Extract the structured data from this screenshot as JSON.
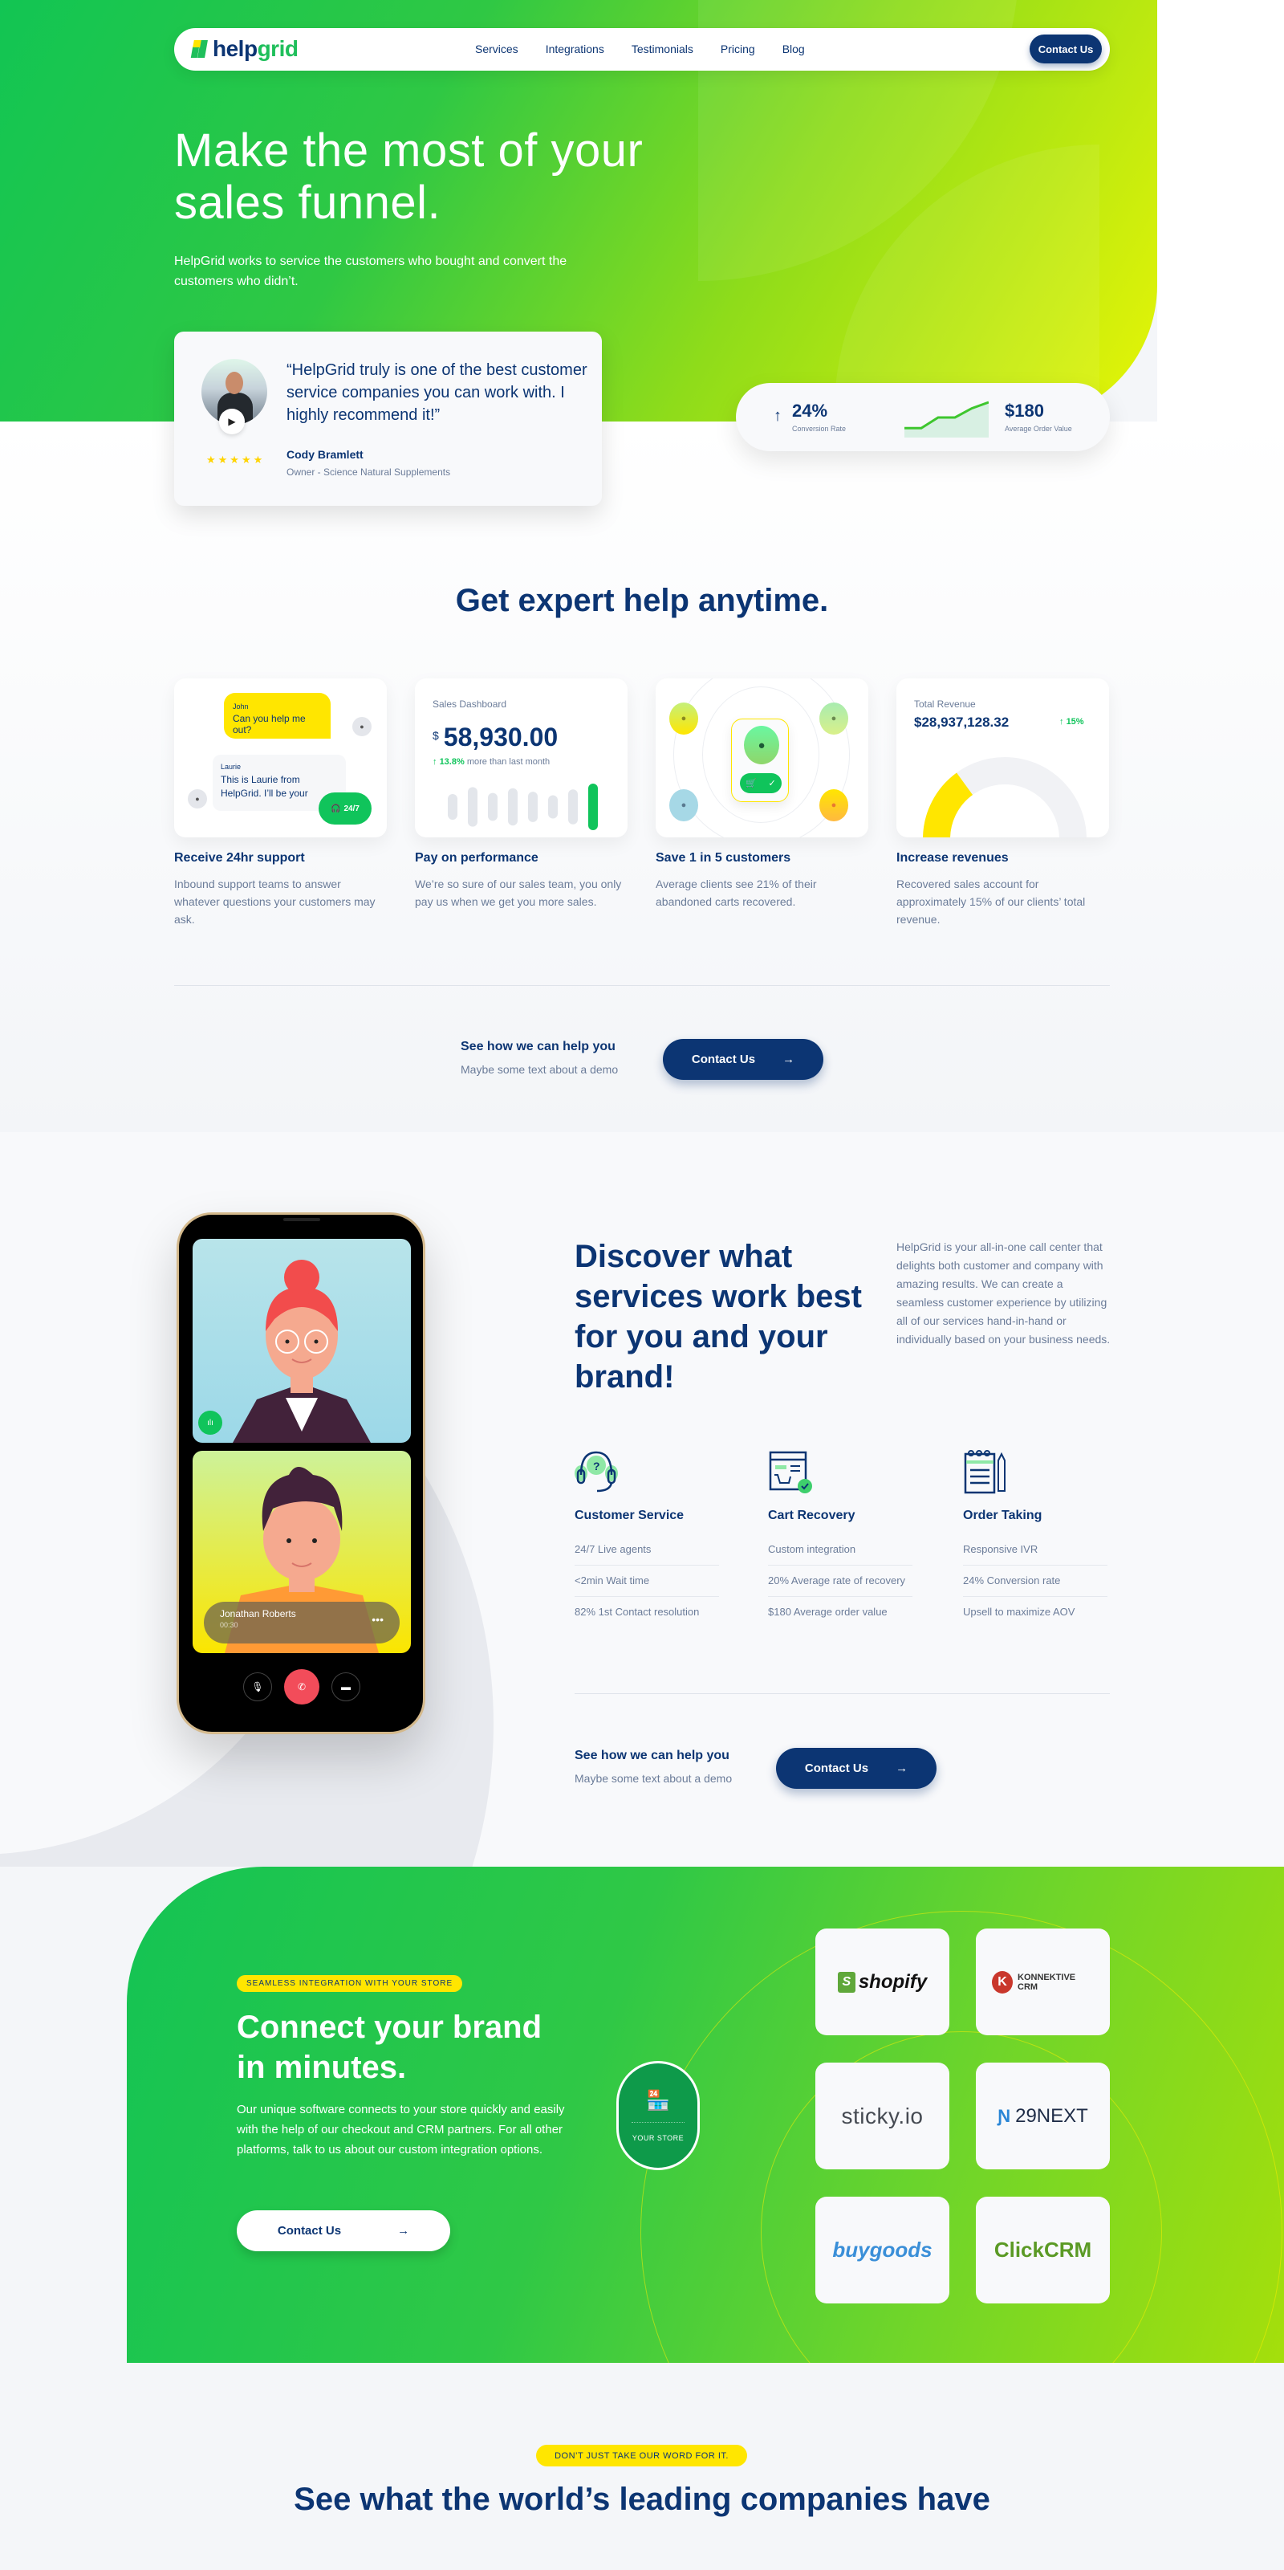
{
  "brand": {
    "name_part1": "help",
    "name_part2": "grid",
    "accent": "#1fbf5b",
    "navy": "#0c3573",
    "yellow": "#ffe600"
  },
  "nav": {
    "links": [
      "Services",
      "Integrations",
      "Testimonials",
      "Pricing",
      "Blog"
    ],
    "cta_label": "Contact Us"
  },
  "hero": {
    "title": "Make the most of your sales funnel.",
    "subtitle": "HelpGrid works to service the customers who bought and convert the customers who didn’t.",
    "testimonial": {
      "quote": "“HelpGrid truly is one of the best customer service companies you can work with. I highly recommend it!”",
      "name": "Cody Bramlett",
      "role": "Owner - Science Natural Supplements",
      "rating": 5,
      "stars": "★★★★★",
      "play_icon": "▶"
    },
    "stats": {
      "arrow": "↑",
      "conversion_value": "24%",
      "conversion_label": "Conversion Rate",
      "aov_value": "$180",
      "aov_label": "Average Order Value",
      "sparkline": [
        0.15,
        0.15,
        0.5,
        0.5,
        0.8,
        1.0
      ]
    }
  },
  "features": {
    "title": "Get expert help anytime.",
    "items": [
      {
        "title": "Receive 24hr support",
        "desc": "Inbound support teams to answer whatever questions your customers may ask.",
        "chat_user_name": "John",
        "chat_user_msg": "Can you help me out?",
        "chat_agent_name": "Laurie",
        "chat_agent_msg": "This is Laurie from HelpGrid. I’ll be your assistant today.",
        "badge": "24/7"
      },
      {
        "title": "Pay on performance",
        "desc": "We’re so sure of our sales team, you only pay us when we get you more sales.",
        "dash_label": "Sales Dashboard",
        "currency": "$",
        "amount": "58,930.00",
        "delta": "13.8%",
        "delta_text": "more than last month",
        "bars": [
          0.55,
          0.85,
          0.6,
          0.8,
          0.65,
          0.5,
          0.75,
          1.0
        ]
      },
      {
        "title": "Save 1 in 5 customers",
        "desc": "Average clients see 21% of their abandoned carts recovered."
      },
      {
        "title": "Increase revenues",
        "desc": "Recovered sales account for approximately 15% of our clients’ total revenue.",
        "rev_label": "Total Revenue",
        "rev_value": "$28,937,128.32",
        "rev_delta": "15%",
        "gauge_fraction": 0.15
      }
    ],
    "cta": {
      "title": "See how we can help you",
      "subtitle": "Maybe some text about a demo",
      "button": "Contact Us",
      "arrow": "→"
    }
  },
  "services": {
    "title": "Discover what services work best for you and your brand!",
    "desc": "HelpGrid is your all-in-one call center that delights both customer and company with amazing results. We can create a seamless customer experience by utilizing all of our services hand-in-hand or individually based on your business needs.",
    "phone": {
      "caller_name": "Jonathan Roberts",
      "call_time": "00:30",
      "more": "•••"
    },
    "columns": [
      {
        "title": "Customer Service",
        "icon": "headset-icon",
        "items": [
          "24/7 Live agents",
          "<2min Wait time",
          "82% 1st Contact resolution"
        ]
      },
      {
        "title": "Cart Recovery",
        "icon": "cart-browser-icon",
        "items": [
          "Custom integration",
          "20% Average rate of recovery",
          "$180 Average order value"
        ]
      },
      {
        "title": "Order Taking",
        "icon": "notepad-icon",
        "items": [
          "Responsive IVR",
          "24% Conversion rate",
          "Upsell to maximize AOV"
        ]
      }
    ],
    "cta": {
      "title": "See how we can help you",
      "subtitle": "Maybe some text about a demo",
      "button": "Contact Us",
      "arrow": "→"
    }
  },
  "integrations": {
    "tag": "SEAMLESS INTEGRATION WITH YOUR STORE",
    "title": "Connect your brand in minutes.",
    "desc": "Our unique software connects to your store quickly and easily with the help of our checkout and CRM partners. For all other platforms, talk to us about our custom integration options.",
    "button": "Contact Us",
    "arrow": "→",
    "store_label": "YOUR STORE",
    "partners": [
      "shopify",
      "KONNEKTIVE CRM",
      "sticky.io",
      "29NEXT",
      "buygoods",
      "ClickCRM"
    ]
  },
  "testimonials": {
    "tag": "DON’T JUST TAKE OUR WORD FOR IT.",
    "title": "See what the world’s leading companies have"
  }
}
